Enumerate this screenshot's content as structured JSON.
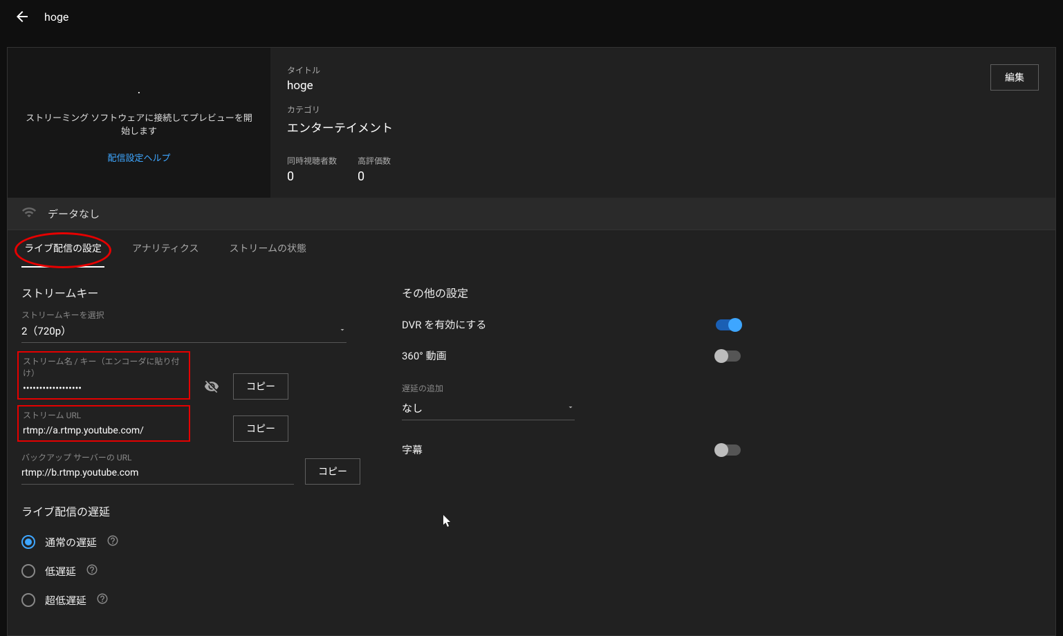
{
  "header": {
    "title": "hoge"
  },
  "preview": {
    "message": "ストリーミング ソフトウェアに接続してプレビューを開始します",
    "help_link": "配信設定ヘルプ"
  },
  "info": {
    "title_label": "タイトル",
    "title_value": "hoge",
    "category_label": "カテゴリ",
    "category_value": "エンターテイメント",
    "viewers_label": "同時視聴者数",
    "viewers_value": "0",
    "likes_label": "高評価数",
    "likes_value": "0",
    "edit_button": "編集"
  },
  "status": {
    "text": "データなし"
  },
  "tabs": {
    "settings": "ライブ配信の設定",
    "analytics": "アナリティクス",
    "health": "ストリームの状態"
  },
  "stream": {
    "section_title": "ストリームキー",
    "select_label": "ストリームキーを選択",
    "select_value": "2（720p）",
    "key_label": "ストリーム名 / キー（エンコーダに貼り付け）",
    "key_value": "••••••••••••••••••",
    "url_label": "ストリーム URL",
    "url_value": "rtmp://a.rtmp.youtube.com/",
    "backup_label": "バックアップ サーバーの URL",
    "backup_value": "rtmp://b.rtmp.youtube.com",
    "copy_button": "コピー"
  },
  "latency": {
    "section_title": "ライブ配信の遅延",
    "normal": "通常の遅延",
    "low": "低遅延",
    "ultralow": "超低遅延"
  },
  "other": {
    "section_title": "その他の設定",
    "dvr": "DVR を有効にする",
    "video360": "360° 動画",
    "delay_add_label": "遅延の追加",
    "delay_add_value": "なし",
    "captions": "字幕"
  }
}
